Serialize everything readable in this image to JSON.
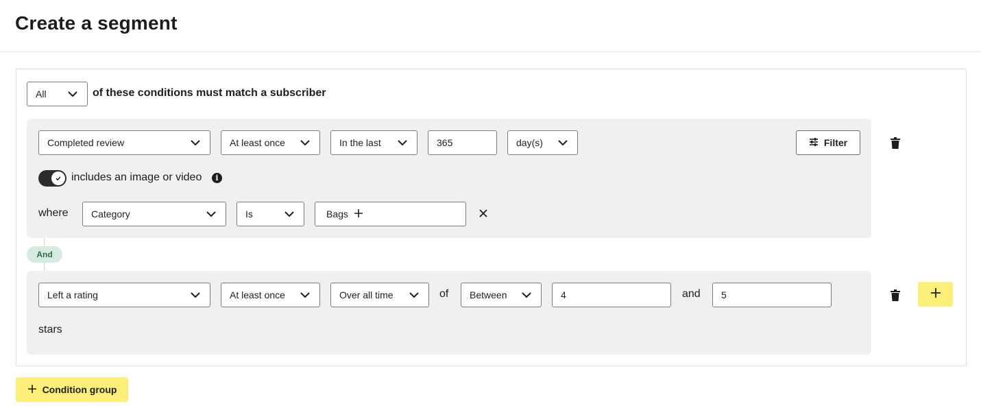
{
  "page": {
    "title": "Create a segment"
  },
  "match": {
    "quantifier": "All",
    "text": "of these conditions must match a subscriber"
  },
  "condition1": {
    "event": "Completed review",
    "frequency": "At least once",
    "timeframe": "In the last",
    "amount": "365",
    "unit": "day(s)",
    "filter_label": "Filter",
    "toggle_label": "includes an image or video",
    "toggle_on": true,
    "where_label": "where",
    "property": "Category",
    "operator": "Is",
    "value_tag": "Bags"
  },
  "connector": {
    "label": "And"
  },
  "condition2": {
    "event": "Left a rating",
    "frequency": "At least once",
    "timeframe": "Over all time",
    "of_label": "of",
    "comparator": "Between",
    "min": "4",
    "and_label": "and",
    "max": "5",
    "suffix": "stars"
  },
  "footer": {
    "condition_group_label": "Condition group"
  },
  "colors": {
    "accent_yellow": "#fbef7a",
    "and_badge_bg": "#d6ebdf",
    "and_badge_text": "#2f6b45",
    "condition_bg": "#eff0ef"
  },
  "icons": [
    "chevron-down-icon",
    "filter-sliders-icon",
    "trash-icon",
    "info-icon",
    "check-icon",
    "plus-icon",
    "close-icon"
  ]
}
